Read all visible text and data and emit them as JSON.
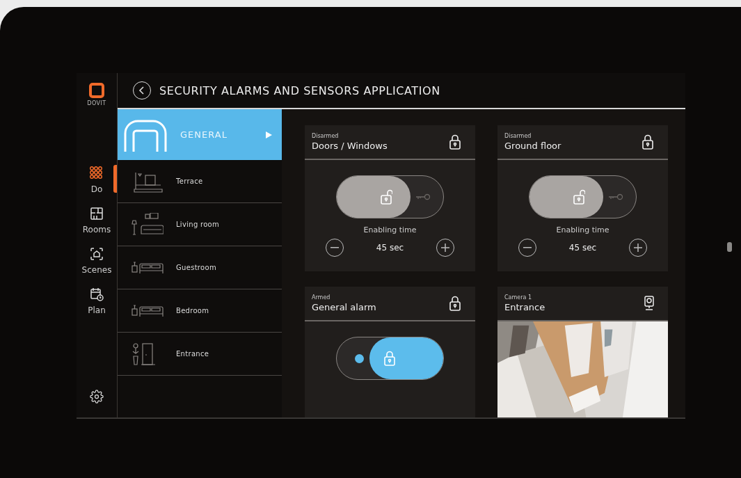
{
  "brand": {
    "name": "DOVIT"
  },
  "nav": [
    {
      "label": "Do",
      "selected": true
    },
    {
      "label": "Rooms",
      "selected": false
    },
    {
      "label": "Scenes",
      "selected": false
    },
    {
      "label": "Plan",
      "selected": false
    }
  ],
  "title": "SECURITY ALARMS AND SENSORS APPLICATION",
  "rooms": [
    {
      "label": "GENERAL",
      "selected": true
    },
    {
      "label": "Terrace",
      "selected": false
    },
    {
      "label": "Living room",
      "selected": false
    },
    {
      "label": "Guestroom",
      "selected": false
    },
    {
      "label": "Bedroom",
      "selected": false
    },
    {
      "label": "Entrance",
      "selected": false
    }
  ],
  "cards": [
    {
      "kind": "toggle",
      "status": "Disarmed",
      "name": "Doors / Windows",
      "armed": false,
      "caption": "Enabling time",
      "value": "45 sec"
    },
    {
      "kind": "toggle",
      "status": "Disarmed",
      "name": "Ground floor",
      "armed": false,
      "caption": "Enabling time",
      "value": "45 sec"
    },
    {
      "kind": "toggle",
      "status": "Armed",
      "name": "General alarm",
      "armed": true
    },
    {
      "kind": "camera",
      "status": "Camera 1",
      "name": "Entrance"
    }
  ]
}
